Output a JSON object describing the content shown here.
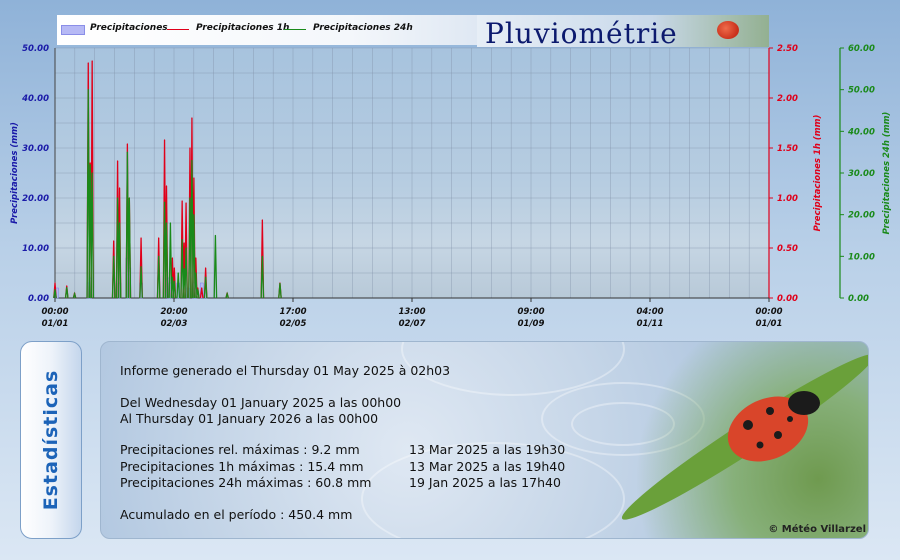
{
  "legend": {
    "items": [
      {
        "label": "Precipitaciones",
        "color": "#b6b9f5"
      },
      {
        "label": "Precipitaciones 1h",
        "color": "#e0001a"
      },
      {
        "label": "Precipitaciones 24h",
        "color": "#1a8a1a"
      }
    ]
  },
  "title": "Pluviométrie",
  "chart_data": {
    "type": "bar",
    "title": "Pluviométrie",
    "x_ticks": [
      {
        "time": "00:00",
        "date": "01/01"
      },
      {
        "time": "20:00",
        "date": "02/03"
      },
      {
        "time": "17:00",
        "date": "02/05"
      },
      {
        "time": "13:00",
        "date": "02/07"
      },
      {
        "time": "09:00",
        "date": "01/09"
      },
      {
        "time": "04:00",
        "date": "01/11"
      },
      {
        "time": "00:00",
        "date": "01/01"
      }
    ],
    "x_range_days": [
      0,
      365
    ],
    "y_left": {
      "label": "Precipitaciones (mm)",
      "ylim": [
        0,
        50
      ],
      "ticks": [
        "0.00",
        "10.00",
        "20.00",
        "30.00",
        "40.00",
        "50.00"
      ],
      "color": "#1a1aa8"
    },
    "y_right1": {
      "label": "Precipitaciones 1h (mm)",
      "ylim": [
        0,
        2.5
      ],
      "ticks": [
        "0.00",
        "0.50",
        "1.00",
        "1.50",
        "2.00",
        "2.50"
      ],
      "color": "#e0001a"
    },
    "y_right2": {
      "label": "Precipitaciones 24h (mm)",
      "ylim": [
        0,
        60
      ],
      "ticks": [
        "0.00",
        "10.00",
        "20.00",
        "30.00",
        "40.00",
        "50.00",
        "60.00"
      ],
      "color": "#1a8a1a"
    },
    "grid": true,
    "series": [
      {
        "name": "Precipitaciones",
        "axis": "left",
        "color": "#b6b9f5",
        "points": [
          [
            1,
            2
          ],
          [
            17,
            3
          ],
          [
            18,
            4
          ],
          [
            33,
            3
          ],
          [
            37,
            8
          ],
          [
            38,
            6
          ],
          [
            44,
            3
          ],
          [
            58,
            4
          ],
          [
            59,
            3
          ],
          [
            63,
            3
          ],
          [
            68,
            2
          ],
          [
            71,
            3
          ],
          [
            72,
            2
          ],
          [
            75,
            3
          ],
          [
            77,
            1
          ]
        ]
      },
      {
        "name": "Precipitaciones 1h",
        "axis": "right1",
        "color": "#e0001a",
        "points": [
          [
            0,
            0.15
          ],
          [
            6,
            0.12
          ],
          [
            10,
            0.05
          ],
          [
            17,
            2.35
          ],
          [
            18,
            1.35
          ],
          [
            19,
            2.37
          ],
          [
            30,
            0.57
          ],
          [
            32,
            1.37
          ],
          [
            33,
            1.1
          ],
          [
            37,
            1.54
          ],
          [
            38,
            1.0
          ],
          [
            44,
            0.6
          ],
          [
            53,
            0.6
          ],
          [
            56,
            1.58
          ],
          [
            57,
            1.12
          ],
          [
            60,
            0.4
          ],
          [
            61,
            0.3
          ],
          [
            65,
            0.97
          ],
          [
            66,
            0.55
          ],
          [
            67,
            0.95
          ],
          [
            69,
            1.5
          ],
          [
            70,
            1.8
          ],
          [
            71,
            1.2
          ],
          [
            72,
            0.4
          ],
          [
            73,
            0.1
          ],
          [
            75,
            0.1
          ],
          [
            77,
            0.3
          ],
          [
            88,
            0.05
          ],
          [
            106,
            0.78
          ],
          [
            115,
            0.15
          ]
        ]
      },
      {
        "name": "Precipitaciones 24h",
        "axis": "right2",
        "color": "#1a8a1a",
        "points": [
          [
            0,
            2
          ],
          [
            6,
            2.5
          ],
          [
            10,
            1
          ],
          [
            17,
            50
          ],
          [
            18,
            32
          ],
          [
            19,
            30
          ],
          [
            30,
            10
          ],
          [
            32,
            24
          ],
          [
            33,
            18
          ],
          [
            37,
            35
          ],
          [
            38,
            24
          ],
          [
            44,
            7.5
          ],
          [
            53,
            10
          ],
          [
            56,
            23
          ],
          [
            57,
            18
          ],
          [
            59,
            18
          ],
          [
            60,
            5
          ],
          [
            61,
            4
          ],
          [
            63,
            6
          ],
          [
            65,
            14
          ],
          [
            66,
            7
          ],
          [
            67,
            12
          ],
          [
            69,
            24
          ],
          [
            70,
            33
          ],
          [
            71,
            20
          ],
          [
            72,
            6
          ],
          [
            73,
            2
          ],
          [
            77,
            5
          ],
          [
            82,
            15
          ],
          [
            88,
            1
          ],
          [
            106,
            10
          ],
          [
            115,
            3.5
          ]
        ]
      }
    ]
  },
  "stats": {
    "tab_label": "Estadísticas",
    "generated": "Informe generado el Thursday 01 May 2025 à 02h03",
    "from": "Del Wednesday 01 January 2025 a las 00h00",
    "to": "Al Thursday 01 January 2026 a las 00h00",
    "rows": [
      {
        "label": "Precipitaciones rel. máximas : 9.2 mm",
        "when": "13 Mar 2025 a las 19h30"
      },
      {
        "label": "Precipitaciones 1h máximas : 15.4 mm",
        "when": "13 Mar 2025 a las 19h40"
      },
      {
        "label": "Precipitaciones 24h máximas : 60.8 mm",
        "when": "19 Jan 2025 a las 17h40"
      }
    ],
    "cumulative": "Acumulado en el período : 450.4 mm",
    "copyright": "© Météo Villarzel"
  }
}
